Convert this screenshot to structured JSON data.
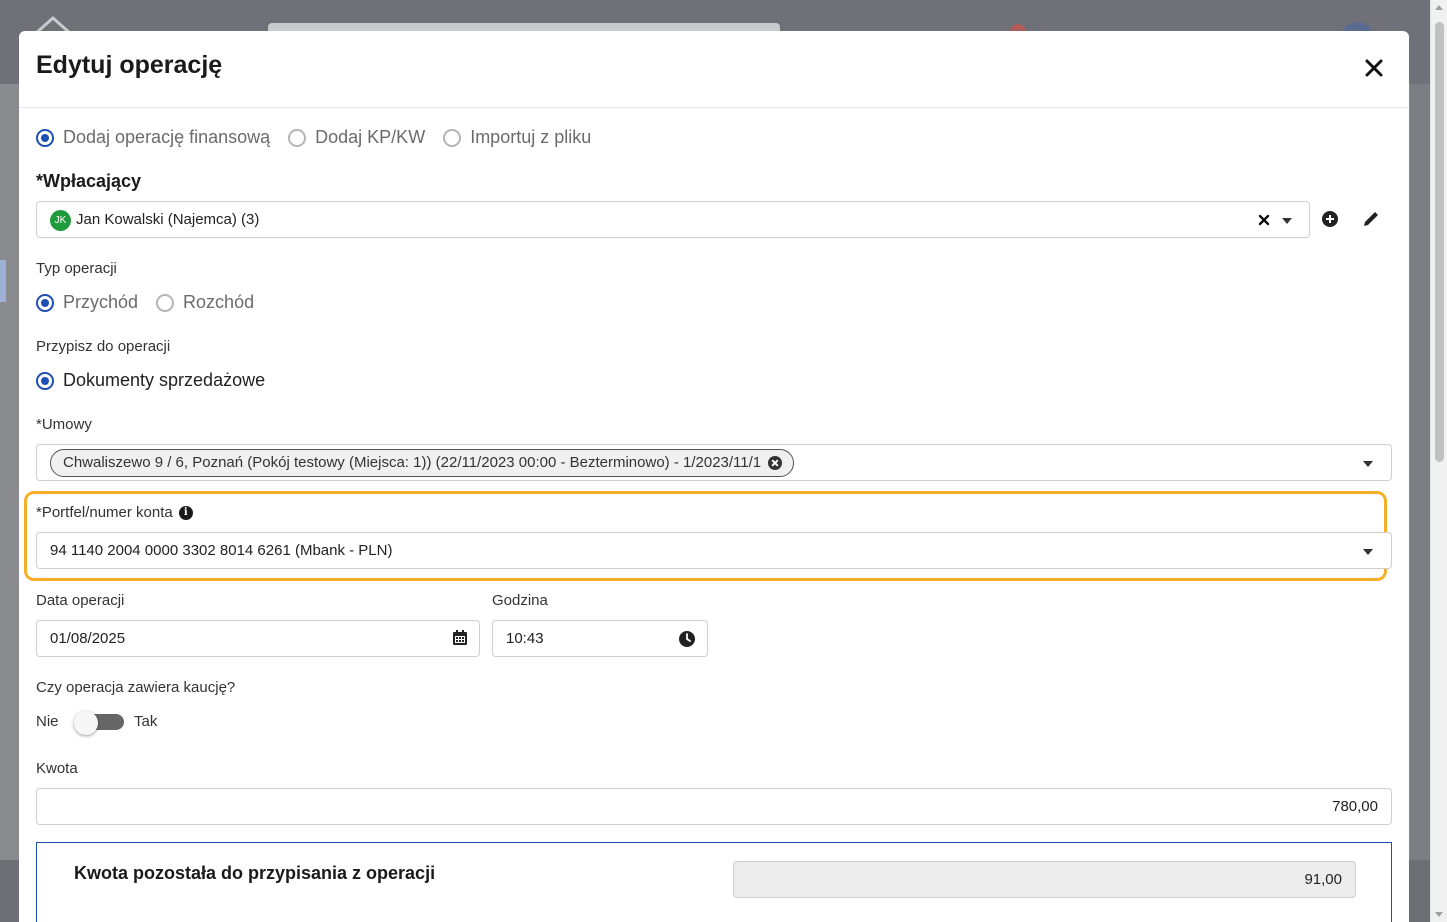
{
  "modal": {
    "title": "Edytuj operację",
    "mode_options": [
      {
        "label": "Dodaj operację finansową",
        "checked": true
      },
      {
        "label": "Dodaj KP/KW",
        "checked": false
      },
      {
        "label": "Importuj z pliku",
        "checked": false
      }
    ],
    "payer": {
      "label": "*Wpłacający",
      "avatar_initials": "JK",
      "value": "Jan Kowalski (Najemca) (3)",
      "actions": [
        "add-circle-icon",
        "pencil-icon"
      ]
    },
    "operation_type": {
      "label": "Typ operacji",
      "options": [
        {
          "label": "Przychód",
          "checked": true
        },
        {
          "label": "Rozchód",
          "checked": false
        }
      ]
    },
    "assign": {
      "label": "Przypisz do operacji",
      "option": "Dokumenty sprzedażowe"
    },
    "contracts": {
      "label": "*Umowy",
      "chip": "Chwaliszewo 9 / 6, Poznań (Pokój testowy (Miejsca: 1)) (22/11/2023 00:00 - Bezterminowo) - 1/2023/11/1"
    },
    "wallet": {
      "label": "*Portfel/numer konta",
      "value": "94 1140 2004 0000 3302 8014 6261 (Mbank - PLN)",
      "highlight_color": "#f5b02a"
    },
    "date": {
      "label": "Data operacji",
      "value": "01/08/2025"
    },
    "time": {
      "label": "Godzina",
      "value": "10:43"
    },
    "deposit": {
      "label": "Czy operacja zawiera kaucję?",
      "off_label": "Nie",
      "on_label": "Tak",
      "enabled": false
    },
    "amount": {
      "label": "Kwota",
      "value": "780,00"
    },
    "remaining": {
      "label": "Kwota pozostała do przypisania z operacji",
      "value": "91,00"
    }
  },
  "colors": {
    "accent": "#1e4fb3",
    "avatar_green": "#1f9b3d"
  }
}
